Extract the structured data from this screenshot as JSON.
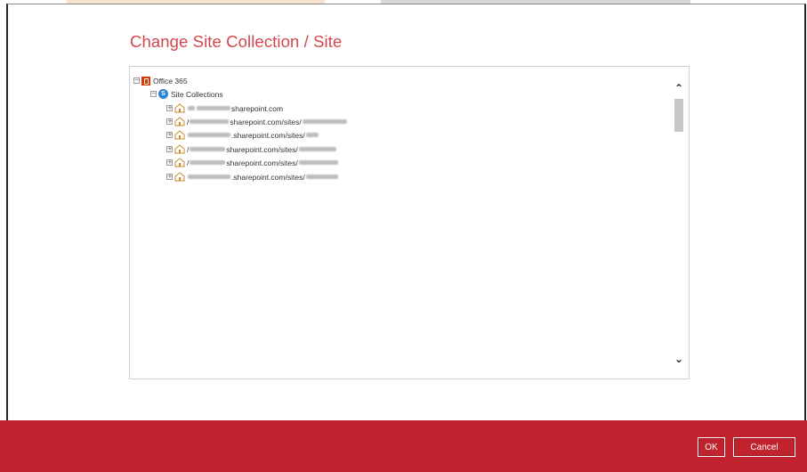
{
  "dialog": {
    "title": "Change Site Collection / Site"
  },
  "tree": {
    "root": {
      "label": "Office 365",
      "expander": "−",
      "icon": "office365-icon"
    },
    "collections": {
      "label": "Site Collections",
      "expander": "−",
      "icon": "sharepoint-icon"
    },
    "sites": [
      {
        "expander": "+",
        "icon": "site-icon",
        "prefix": "",
        "text": "sharepoint.com",
        "suffix": ""
      },
      {
        "expander": "+",
        "icon": "site-icon",
        "prefix": "/",
        "text": "sharepoint.com/sites/",
        "suffix": ""
      },
      {
        "expander": "+",
        "icon": "site-icon",
        "prefix": "",
        "text": ".sharepoint.com/sites/",
        "suffix": ""
      },
      {
        "expander": "+",
        "icon": "site-icon",
        "prefix": "/",
        "text": "sharepoint.com/sites/",
        "suffix": ""
      },
      {
        "expander": "+",
        "icon": "site-icon",
        "prefix": "/",
        "text": "sharepoint.com/sites/",
        "suffix": ""
      },
      {
        "expander": "+",
        "icon": "site-icon",
        "prefix": "",
        "text": ".sharepoint.com/sites/",
        "suffix": ""
      }
    ]
  },
  "scrollbar": {
    "up": "⌃",
    "down": "⌄"
  },
  "buttons": {
    "ok": "OK",
    "cancel": "Cancel"
  },
  "colors": {
    "accent": "#c0222e",
    "title": "#d2474f"
  }
}
